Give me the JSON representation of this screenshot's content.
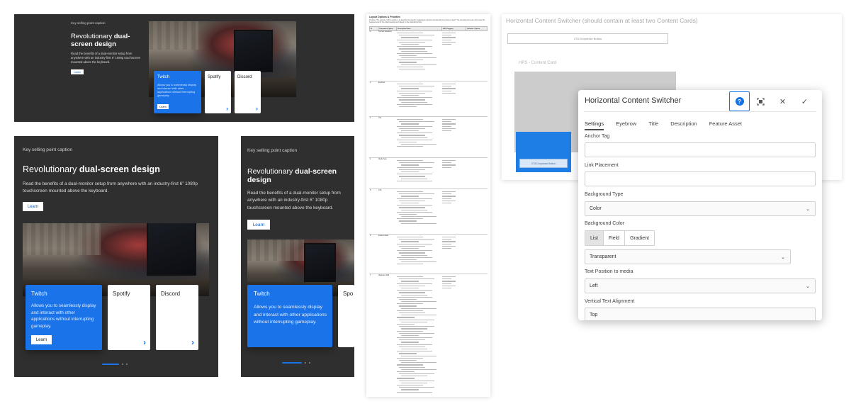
{
  "marketing": {
    "ksp": "Key selling point caption",
    "headline_regular": "Revolutionary ",
    "headline_bold": "dual-screen design",
    "headline_bold_short": "dual-",
    "headline_bold_rest": "screen design",
    "body": "Read the benefits of a dual-monitor setup from anywhere with an industry-first 6” 1080p touchscreen mounted above the keyboard.",
    "learn": "Learn",
    "cards": [
      {
        "name": "Twitch",
        "desc": "Allows you to seamlessly display and interact with other applications without interrupting gameplay.",
        "cta": "Learn"
      },
      {
        "name": "Spotify",
        "chevron": "›"
      },
      {
        "name": "Discord",
        "chevron": "›"
      }
    ],
    "card_cut": "Spo"
  },
  "document": {
    "title": "Layout Options & Priorities",
    "intro": "Purpose: The purpose of this section is to describe the specific image/layout options and identify the priority of each. The development team will review the requirements for the initial development based on the identified priority.",
    "columns": [
      "ID",
      "Component Option",
      "Description Notes",
      "MVP Flagging",
      "Variation / Option"
    ],
    "rows": [
      {
        "id": "1",
        "name": "Content Variations"
      },
      {
        "id": "2",
        "name": "Eyebrow"
      },
      {
        "id": "3",
        "name": "Title"
      },
      {
        "id": "4",
        "name": "Media Type"
      },
      {
        "id": "5",
        "name": "CTA"
      },
      {
        "id": "6",
        "name": "Feature Asset"
      },
      {
        "id": "7",
        "name": "Alignment Grid"
      }
    ]
  },
  "author": {
    "title": "Horizontal Content Switcher (should contain at least two Content Cards)",
    "cta_dropdown": "CTA Dropdown Button",
    "hps_label": "HPS - Content Card",
    "hps_cta": "CTA Dropdown Button"
  },
  "dialog": {
    "title": "Horizontal Content Switcher",
    "tabs": [
      "Settings",
      "Eyebrow",
      "Title",
      "Description",
      "Feature Asset"
    ],
    "anchor_tag_label": "Anchor Tag",
    "link_placement_label": "Link Placement",
    "background_type_label": "Background Type",
    "background_type_value": "Color",
    "background_color_label": "Background Color",
    "color_modes": [
      "List",
      "Field",
      "Gradient"
    ],
    "background_color_value": "Transparent",
    "text_position_label": "Text Position to media",
    "text_position_value": "Left",
    "vertical_align_label": "Vertical Text Alignment",
    "vertical_align_value": "Top"
  },
  "colors": {
    "accent": "#1a73e8",
    "dark_bg": "#2f2f2f",
    "adobe_blue": "#1473e6"
  }
}
